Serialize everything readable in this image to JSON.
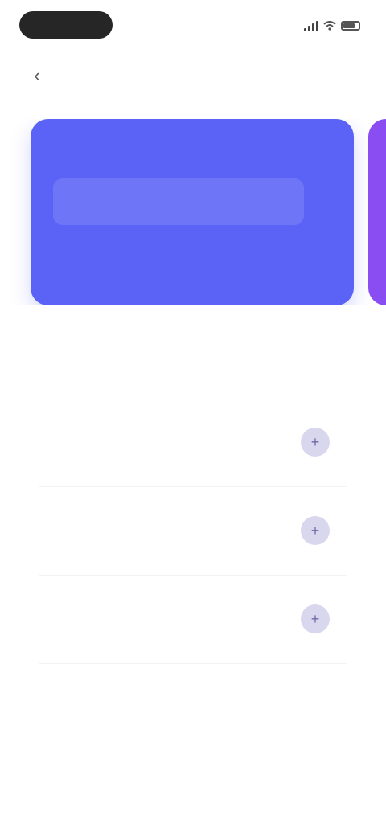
{
  "status_bar": {
    "time": "",
    "accent": "#262626"
  },
  "nav": {
    "back_glyph": "‹",
    "title": ""
  },
  "hero_card": {
    "title": "",
    "subtitle": "",
    "field_text": "",
    "color": "#5b63f6"
  },
  "peek_card": {
    "color": "#8a4df2"
  },
  "section": {
    "title": "",
    "subtitle": ""
  },
  "list": {
    "items": [
      {
        "title": "",
        "subtitle": "",
        "action_icon": "plus-icon",
        "action_glyph": "+"
      },
      {
        "title": "",
        "subtitle": "",
        "action_icon": "plus-icon",
        "action_glyph": "+"
      },
      {
        "title": "",
        "subtitle": "",
        "action_icon": "plus-icon",
        "action_glyph": "+"
      }
    ]
  },
  "icons": {
    "signal": "signal-icon",
    "wifi": "wifi-icon",
    "battery": "battery-icon",
    "back": "chevron-left-icon"
  }
}
